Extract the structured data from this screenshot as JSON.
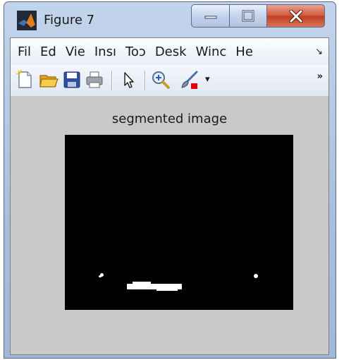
{
  "window": {
    "title": "Figure 7",
    "controls": {
      "minimize": "—",
      "maximize": "□",
      "close": "X"
    }
  },
  "menu": {
    "items": [
      "Fil",
      "Ed",
      "Vie",
      "Insı",
      "Toɔ",
      "Desk",
      "Winc",
      "He"
    ],
    "overflow": "↘"
  },
  "toolbar": {
    "icons": [
      "new-figure-icon",
      "open-file-icon",
      "save-icon",
      "print-icon",
      "select-arrow-icon",
      "zoom-in-icon",
      "brush-icon",
      "dropdown-arrow-icon"
    ],
    "overflow": "»"
  },
  "figure": {
    "title": "segmented image",
    "image_background": "#000000",
    "foreground_color": "#ffffff"
  }
}
